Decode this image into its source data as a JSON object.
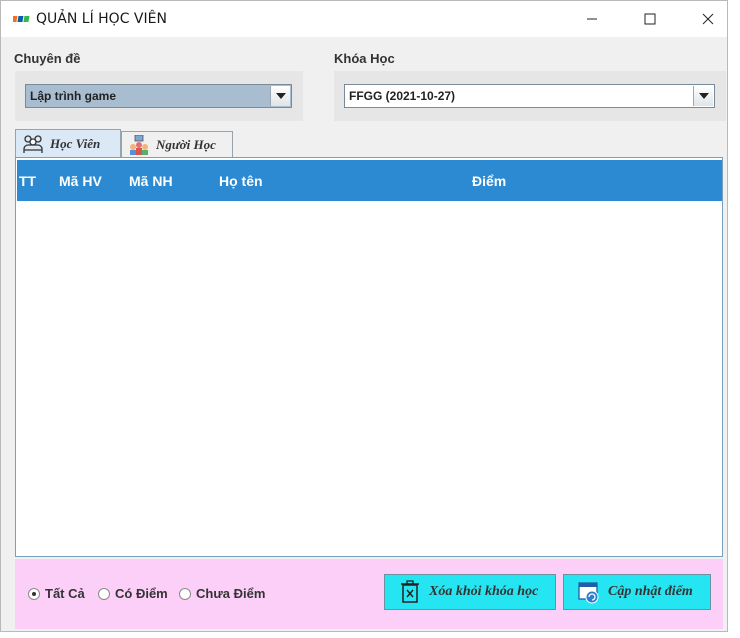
{
  "window": {
    "title": "QUẢN LÍ HỌC VIÊN",
    "icon": "fpt-logo-icon"
  },
  "filters": {
    "chuyen_de_label": "Chuyên đề",
    "chuyen_de_value": "Lập trình game",
    "khoa_hoc_label": "Khóa Học",
    "khoa_hoc_value": "FFGG  (2021-10-27)"
  },
  "tabs": [
    {
      "label": "Học Viên",
      "icon": "students-icon",
      "active": true
    },
    {
      "label": "Người Học",
      "icon": "learners-icon",
      "active": false
    }
  ],
  "table": {
    "columns": [
      "TT",
      "Mã HV",
      "Mã NH",
      "Họ tên",
      "Điểm"
    ],
    "rows": []
  },
  "filter_options": [
    {
      "label": "Tất Cả",
      "checked": true
    },
    {
      "label": "Có Điểm",
      "checked": false
    },
    {
      "label": "Chưa Điểm",
      "checked": false
    }
  ],
  "actions": {
    "remove_label": "Xóa khỏi khóa học",
    "update_label": "Cập nhật điểm"
  },
  "colors": {
    "header_blue": "#2c8ad3",
    "bottom_pink": "#fbcff8",
    "button_cyan": "#25e5f2"
  }
}
